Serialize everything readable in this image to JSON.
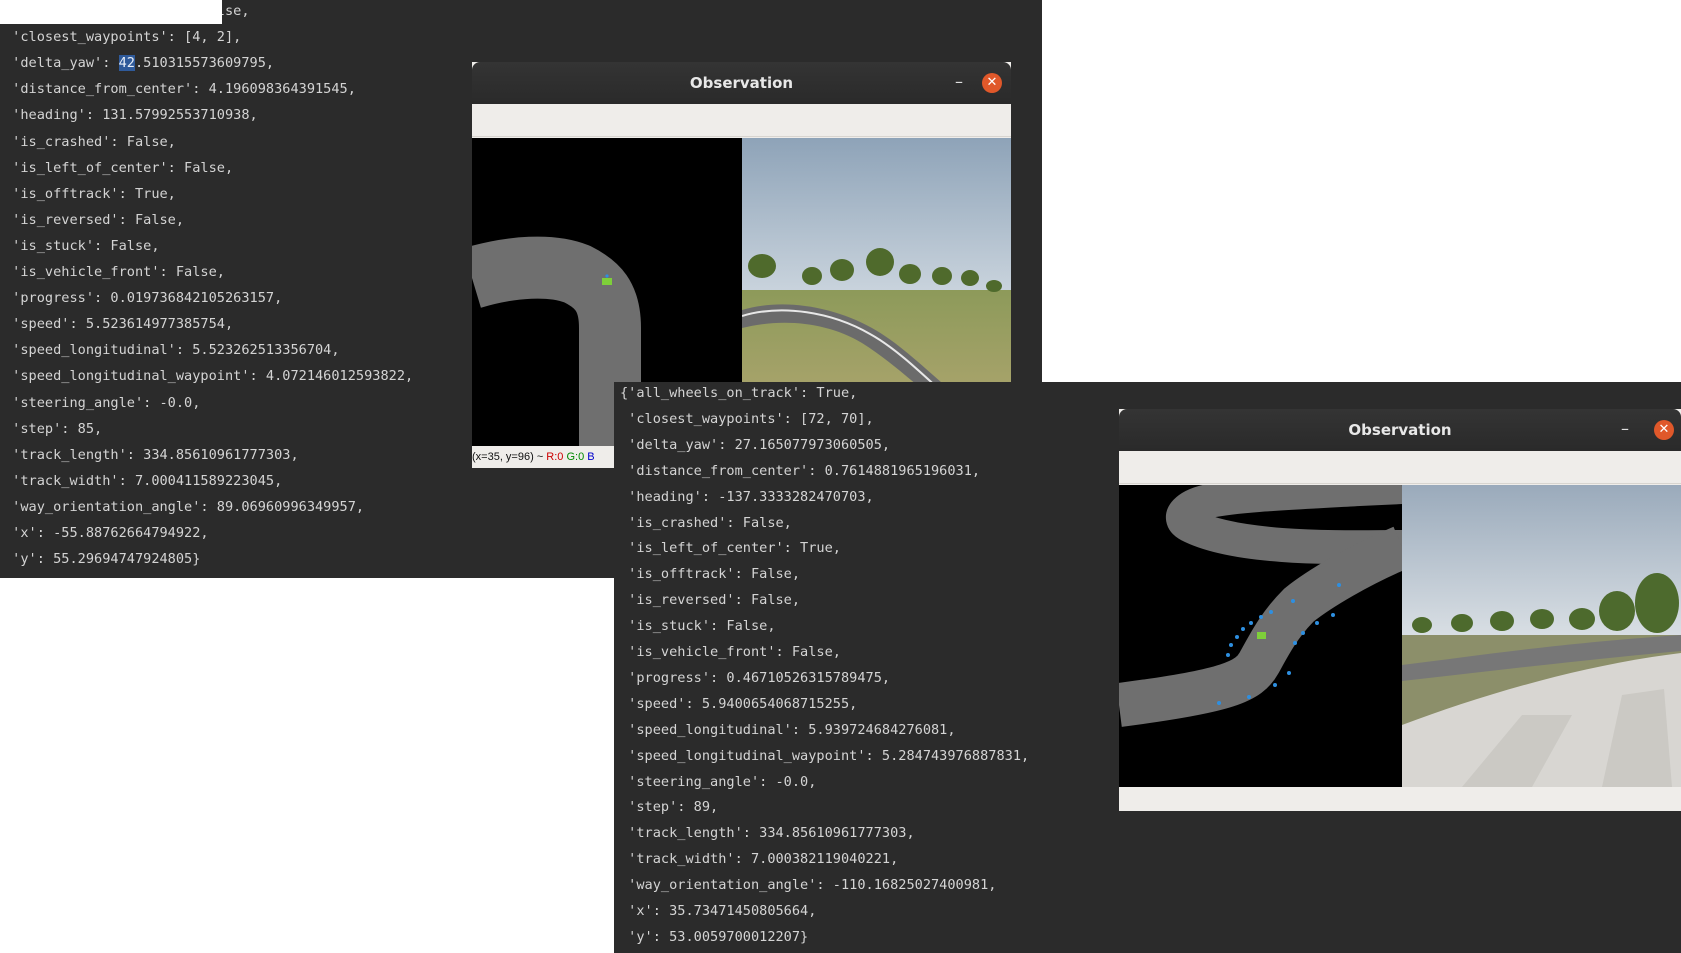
{
  "terminal_1": {
    "lines": [
      "{'all_wheels_on_track': False,",
      " 'closest_waypoints': [4, 2],",
      " 'delta_yaw': 42.510315573609795,",
      " 'distance_from_center': 4.196098364391545,",
      " 'heading': 131.57992553710938,",
      " 'is_crashed': False,",
      " 'is_left_of_center': False,",
      " 'is_offtrack': True,",
      " 'is_reversed': False,",
      " 'is_stuck': False,",
      " 'is_vehicle_front': False,",
      " 'progress': 0.019736842105263157,",
      " 'speed': 5.523614977385754,",
      " 'speed_longitudinal': 5.523262513356704,",
      " 'speed_longitudinal_waypoint': 4.072146012593822,",
      " 'steering_angle': -0.0,",
      " 'step': 85,",
      " 'track_length': 334.85610961777303,",
      " 'track_width': 7.000411589223045,",
      " 'way_orientation_angle': 89.06960996349957,",
      " 'x': -55.88762664794922,",
      " 'y': 55.29694747924805}"
    ],
    "selection": {
      "before": " 'delta_yaw': ",
      "selected": "42",
      "after": ".510315573609795,"
    }
  },
  "terminal_2": {
    "lines": [
      "{'all_wheels_on_track': True,",
      " 'closest_waypoints': [72, 70],",
      " 'delta_yaw': 27.165077973060505,",
      " 'distance_from_center': 0.7614881965196031,",
      " 'heading': -137.3333282470703,",
      " 'is_crashed': False,",
      " 'is_left_of_center': True,",
      " 'is_offtrack': False,",
      " 'is_reversed': False,",
      " 'is_stuck': False,",
      " 'is_vehicle_front': False,",
      " 'progress': 0.46710526315789475,",
      " 'speed': 5.9400654068715255,",
      " 'speed_longitudinal': 5.939724684276081,",
      " 'speed_longitudinal_waypoint': 5.284743976887831,",
      " 'steering_angle': -0.0,",
      " 'step': 89,",
      " 'track_length': 334.85610961777303,",
      " 'track_width': 7.000382119040221,",
      " 'way_orientation_angle': -110.16825027400981,",
      " 'x': 35.73471450805664,",
      " 'y': 53.0059700012207}"
    ]
  },
  "window_1": {
    "title": "Observation",
    "minimize_glyph": "–",
    "close_glyph": "✕",
    "status": {
      "coords": "(x=35, y=96) ~ ",
      "r": "R:0",
      "g": "G:0",
      "b": "B"
    }
  },
  "window_2": {
    "title": "Observation",
    "minimize_glyph": "–",
    "close_glyph": "✕"
  },
  "colors": {
    "terminal_bg": "#2b2b2b",
    "terminal_fg": "#d4d4d4",
    "selection": "#2f5a9a",
    "close_button": "#e0582a",
    "track": "#6f6f6f",
    "car_marker": "#7ecf3a",
    "waypoint": "#2e8fe0"
  },
  "icons": {
    "minimize": "minimize-icon",
    "close": "close-icon",
    "car": "car-marker-icon",
    "waypoints": "waypoint-dot-icon"
  }
}
